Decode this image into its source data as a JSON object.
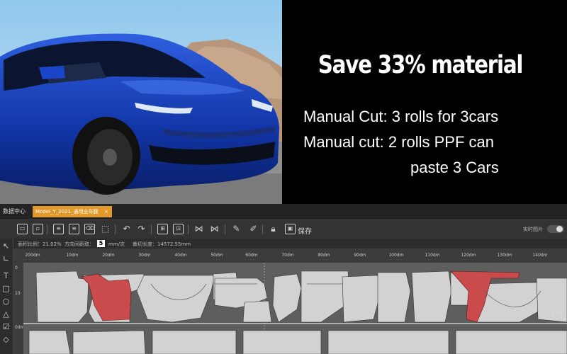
{
  "promo": {
    "headline": "Save 33% material",
    "lines": [
      "Manual Cut: 3 rolls for  3cars",
      "Manual cut:  2 rolls PPF can",
      "paste 3 Cars"
    ]
  },
  "app": {
    "tabs": [
      {
        "label": "数据中心"
      },
      {
        "label": "Model_Y_2021_通用全车膜",
        "close": "×"
      }
    ],
    "toolbar": {
      "save_label": "保存",
      "realtime_label": "实时图片",
      "realtime_on": false
    },
    "info": {
      "usage_rate": "面积比例：21.02%",
      "direction_label": "方向间距取：",
      "direction_value": "5",
      "direction_unit": "mm/次",
      "layout_length": "裁切长度：14572.55mm"
    },
    "ruler_labels": [
      "200dm",
      "10dm",
      "20dm",
      "30dm",
      "40dm",
      "50dm",
      "60dm",
      "70dm",
      "80dm",
      "90dm",
      "100dm",
      "110dm",
      "120dm",
      "130dm",
      "140dm"
    ],
    "vruler_labels": [
      "0",
      "10",
      "0dm"
    ],
    "canvas_edge_label": "2.73",
    "colors": {
      "piece": "#d2d2d2",
      "highlight": "#c94b4b",
      "canvas": "#5e5e5e",
      "tab_active": "#e39a2b"
    }
  }
}
